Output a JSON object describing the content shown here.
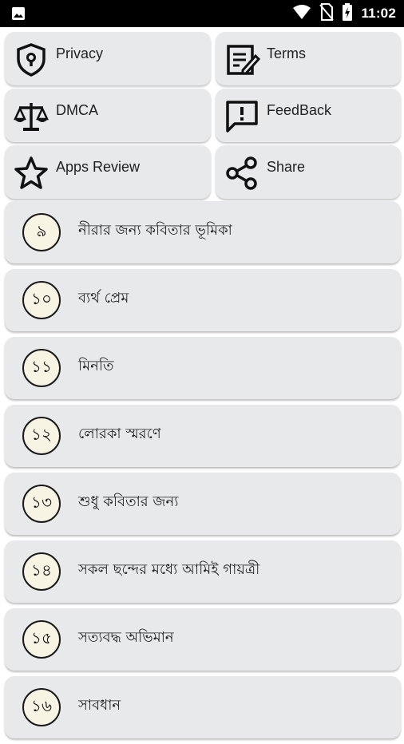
{
  "status_bar": {
    "time": "11:02",
    "icons": [
      "gallery-icon",
      "wifi-icon",
      "no-sim-icon",
      "battery-charging-icon"
    ]
  },
  "menu": [
    {
      "label": "Privacy",
      "icon": "shield-lock-icon"
    },
    {
      "label": "Terms",
      "icon": "document-edit-icon"
    },
    {
      "label": "DMCA",
      "icon": "scales-icon"
    },
    {
      "label": "FeedBack",
      "icon": "feedback-icon"
    },
    {
      "label": "Apps Review",
      "icon": "star-icon"
    },
    {
      "label": "Share",
      "icon": "share-icon"
    }
  ],
  "poems": [
    {
      "number": "৯",
      "title": "নীরার জন্য কবিতার ভূমিকা"
    },
    {
      "number": "১০",
      "title": "ব্যর্থ প্রেম"
    },
    {
      "number": "১১",
      "title": "মিনতি"
    },
    {
      "number": "১২",
      "title": "লোরকা স্মরণে"
    },
    {
      "number": "১৩",
      "title": "শুধু কবিতার জন্য"
    },
    {
      "number": "১৪",
      "title": "সকল ছন্দের মধ্যে আমিই গায়ত্রী"
    },
    {
      "number": "১৫",
      "title": "সত্যবদ্ধ অভিমান"
    },
    {
      "number": "১৬",
      "title": "সাবধান"
    }
  ]
}
